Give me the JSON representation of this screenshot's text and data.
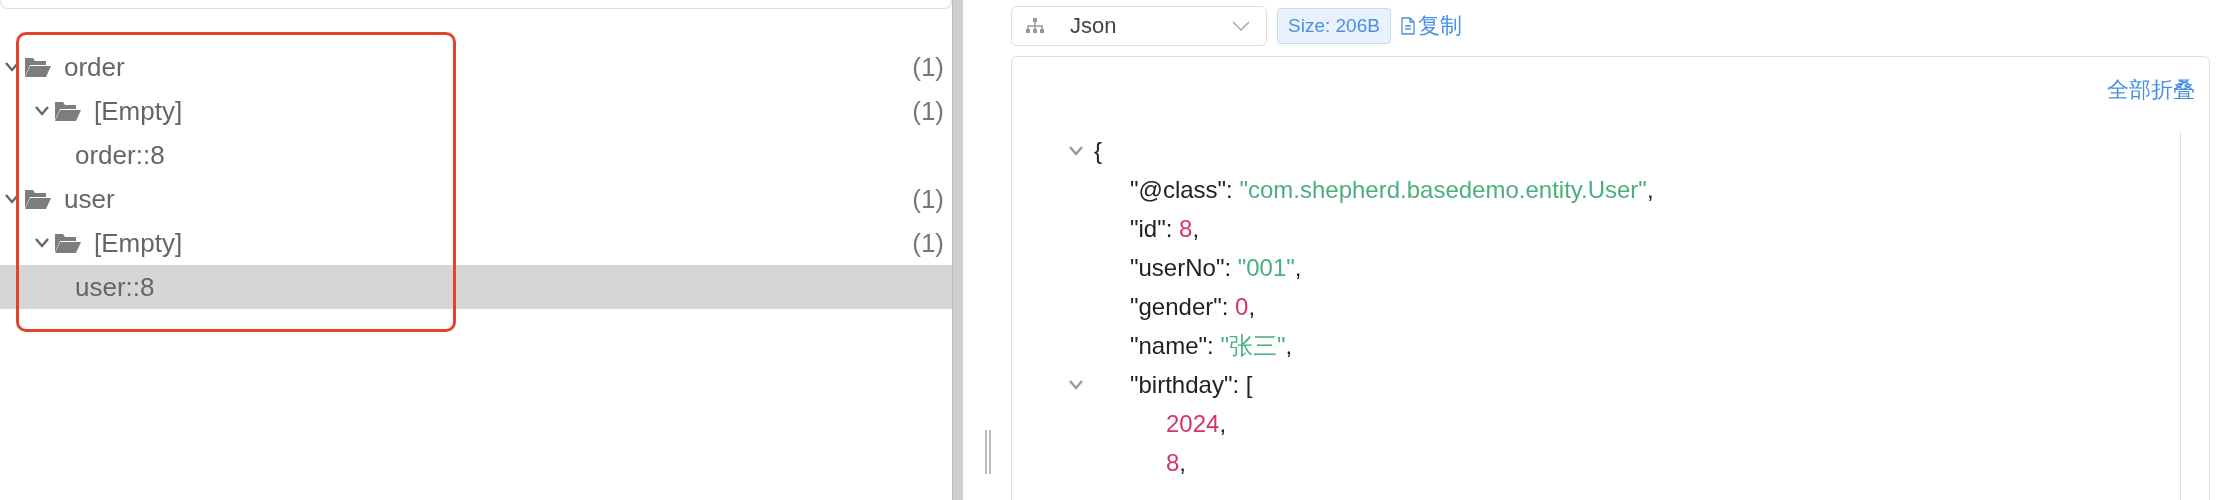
{
  "tree": [
    {
      "label": "order",
      "count": "(1)",
      "expanded": true,
      "selected": false,
      "children": [
        {
          "label": "[Empty]",
          "count": "(1)",
          "expanded": true,
          "selected": false,
          "children": [
            {
              "label": "order::8",
              "selected": false
            }
          ]
        }
      ]
    },
    {
      "label": "user",
      "count": "(1)",
      "expanded": true,
      "selected": false,
      "children": [
        {
          "label": "[Empty]",
          "count": "(1)",
          "expanded": true,
          "selected": false,
          "children": [
            {
              "label": "user::8",
              "selected": true
            }
          ]
        }
      ]
    }
  ],
  "viewer": {
    "format": "Json",
    "size": "Size: 206B",
    "copy": "复制",
    "collapse_all": "全部折叠",
    "json": {
      "open": "{",
      "expanded": true,
      "children": [
        {
          "key": "\"@class\": ",
          "value": "\"com.shepherd.basedemo.entity.User\"",
          "kind": "string",
          "punct": ","
        },
        {
          "key": "\"id\": ",
          "value": "8",
          "kind": "number",
          "punct": ","
        },
        {
          "key": "\"userNo\": ",
          "value": "\"001\"",
          "kind": "string",
          "punct": ","
        },
        {
          "key": "\"gender\": ",
          "value": "0",
          "kind": "number",
          "punct": ","
        },
        {
          "key": "\"name\": ",
          "value": "\"张三\"",
          "kind": "string",
          "punct": ","
        },
        {
          "key": "\"birthday\": ",
          "open": "[",
          "expanded": true,
          "children": [
            {
              "value": "2024",
              "kind": "number",
              "punct": ","
            },
            {
              "value": "8",
              "kind": "number",
              "punct": ","
            }
          ]
        }
      ]
    }
  }
}
